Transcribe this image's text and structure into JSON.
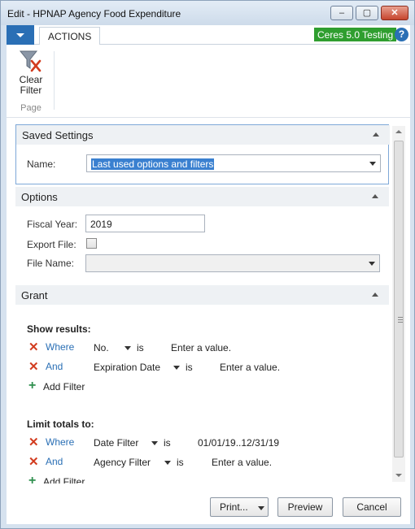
{
  "window": {
    "title": "Edit - HPNAP Agency Food Expenditure",
    "min_glyph": "–",
    "max_glyph": "▢",
    "close_glyph": "✕"
  },
  "ribbon": {
    "menu_tab": "ACTIONS",
    "environment_badge": "Ceres 5.0 Testing",
    "help_glyph": "?",
    "clear_filter_label_1": "Clear",
    "clear_filter_label_2": "Filter",
    "group_label": "Page"
  },
  "saved_settings": {
    "title": "Saved Settings",
    "name_label": "Name:",
    "name_value": "Last used options and filters"
  },
  "options": {
    "title": "Options",
    "fiscal_year_label": "Fiscal Year:",
    "fiscal_year_value": "2019",
    "export_file_label": "Export File:",
    "export_file_checked": false,
    "file_name_label": "File Name:",
    "file_name_value": ""
  },
  "grant": {
    "title": "Grant",
    "show_results_label": "Show results:",
    "show_results": [
      {
        "conj": "Where",
        "field": "No.",
        "op": "is",
        "value": "Enter a value."
      },
      {
        "conj": "And",
        "field": "Expiration Date",
        "op": "is",
        "value": "Enter a value."
      }
    ],
    "add_filter_label": "Add Filter",
    "limit_totals_label": "Limit totals to:",
    "limit_totals": [
      {
        "conj": "Where",
        "field": "Date Filter",
        "op": "is",
        "value": "01/01/19..12/31/19"
      },
      {
        "conj": "And",
        "field": "Agency Filter",
        "op": "is",
        "value": "Enter a value."
      }
    ],
    "add_filter_label_2": "Add Filter"
  },
  "footer": {
    "print_label": "Print...",
    "preview_label": "Preview",
    "cancel_label": "Cancel"
  },
  "colors": {
    "accent": "#2a6fb5",
    "badge_green": "#2f9e2f",
    "remove_red": "#d23c1f",
    "add_green": "#2f8f4e"
  }
}
